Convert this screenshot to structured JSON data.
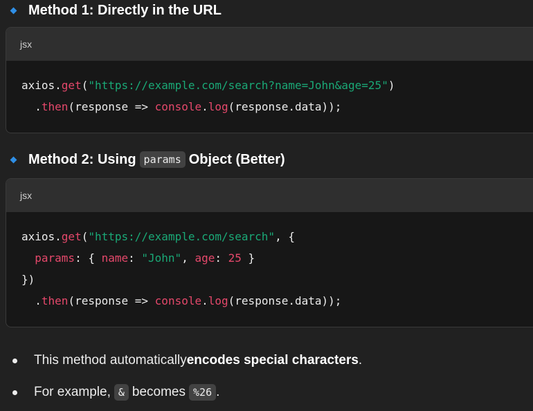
{
  "method1": {
    "heading": "Method 1: Directly in the URL",
    "code_lang": "jsx",
    "code": {
      "l1_obj": "axios.",
      "l1_fn": "get",
      "l1_p1": "(",
      "l1_str": "\"https://example.com/search?name=John&age=25\"",
      "l1_p2": ")",
      "l2_dot": "  .",
      "l2_then": "then",
      "l2_a": "(response => ",
      "l2_console": "console",
      "l2_dot2": ".",
      "l2_log": "log",
      "l2_b": "(response.data));"
    }
  },
  "method2": {
    "heading_pre": "Method 2: Using",
    "heading_code": "params",
    "heading_post": "Object (Better)",
    "code_lang": "jsx",
    "code": {
      "l1_obj": "axios.",
      "l1_fn": "get",
      "l1_p1": "(",
      "l1_str": "\"https://example.com/search\"",
      "l1_p2": ", {",
      "l2_indent": "  ",
      "l2_params": "params",
      "l2_a": ": { ",
      "l2_name": "name",
      "l2_b": ": ",
      "l2_john": "\"John\"",
      "l2_c": ", ",
      "l2_age": "age",
      "l2_d": ": ",
      "l2_num": "25",
      "l2_e": " }",
      "l3": "})",
      "l4_dot": "  .",
      "l4_then": "then",
      "l4_a": "(response => ",
      "l4_console": "console",
      "l4_dot2": ".",
      "l4_log": "log",
      "l4_b": "(response.data));"
    }
  },
  "bullets": {
    "b1_pre": "This method automatically ",
    "b1_bold": "encodes special characters",
    "b1_post": ".",
    "b2_pre": "For example,",
    "b2_code1": "&",
    "b2_mid": "becomes",
    "b2_code2": "%26",
    "b2_post": "."
  },
  "icons": {
    "heading_marker": "blue-diamond",
    "bullet_marker": "white-dot"
  },
  "colors": {
    "background": "#212121",
    "code_bg": "#171717",
    "lang_bar_bg": "#2f2f2f",
    "keyword_red": "#e5486b",
    "string_green": "#1aa876",
    "diamond_blue": "#2f8fe6"
  }
}
